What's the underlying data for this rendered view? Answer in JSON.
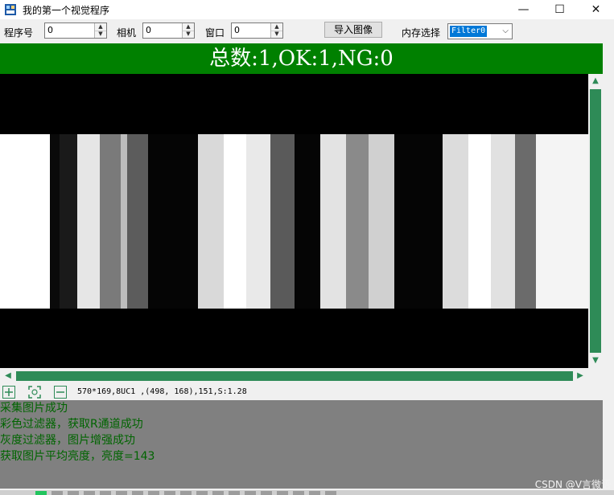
{
  "window": {
    "title": "我的第一个视觉程序",
    "minimize_glyph": "—",
    "maximize_glyph": "☐",
    "close_glyph": "✕"
  },
  "toolbar": {
    "program_label": "程序号",
    "program_value": "0",
    "camera_label": "相机",
    "camera_value": "0",
    "window_label": "窗口",
    "window_value": "0",
    "import_label": "导入图像",
    "memory_label": "内存选择",
    "memory_value": "Filter0"
  },
  "banner": {
    "text": "总数:1,OK:1,NG:0",
    "color": "#008000"
  },
  "status": {
    "info": "570*169,8UC1 ,(498, 168),151,S:1.28"
  },
  "log": {
    "lines": [
      "采集图片成功",
      "彩色过滤器，获取R通道成功",
      "灰度过滤器，图片增强成功",
      "获取图片平均亮度，亮度=143"
    ]
  },
  "watermark": "CSDN @V言微语",
  "colors": {
    "accent": "#2e8b57",
    "log_bg": "#808080",
    "log_text": "#006400"
  }
}
